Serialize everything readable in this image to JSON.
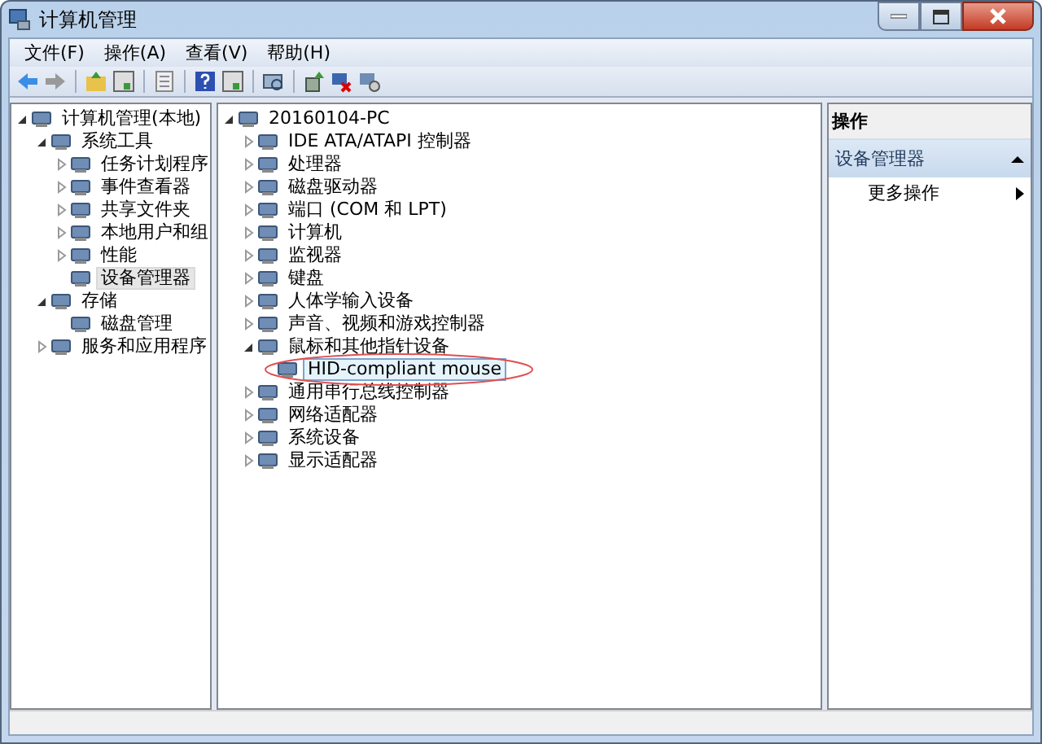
{
  "window": {
    "title": "计算机管理"
  },
  "menu": [
    "文件(F)",
    "操作(A)",
    "查看(V)",
    "帮助(H)"
  ],
  "console_tree": [
    {
      "label": "计算机管理(本地)",
      "selected": false,
      "expanded": true,
      "children": [
        {
          "label": "系统工具",
          "selected": false,
          "expanded": true,
          "children": [
            {
              "label": "任务计划程序",
              "selected": false,
              "expanded": false
            },
            {
              "label": "事件查看器",
              "selected": false,
              "expanded": false
            },
            {
              "label": "共享文件夹",
              "selected": false,
              "expanded": false
            },
            {
              "label": "本地用户和组",
              "selected": false,
              "expanded": false
            },
            {
              "label": "性能",
              "selected": false,
              "expanded": false
            },
            {
              "label": "设备管理器",
              "selected": true
            }
          ]
        },
        {
          "label": "存储",
          "selected": false,
          "expanded": true,
          "children": [
            {
              "label": "磁盘管理",
              "selected": false
            }
          ]
        },
        {
          "label": "服务和应用程序",
          "selected": false,
          "expanded": false
        }
      ]
    }
  ],
  "device_tree": [
    {
      "label": "20160104-PC",
      "selected": false,
      "expanded": true,
      "children": [
        {
          "label": "IDE ATA/ATAPI 控制器",
          "selected": false,
          "expanded": false
        },
        {
          "label": "处理器",
          "selected": false,
          "expanded": false
        },
        {
          "label": "磁盘驱动器",
          "selected": false,
          "expanded": false
        },
        {
          "label": "端口 (COM 和 LPT)",
          "selected": false,
          "expanded": false
        },
        {
          "label": "计算机",
          "selected": false,
          "expanded": false
        },
        {
          "label": "监视器",
          "selected": false,
          "expanded": false
        },
        {
          "label": "键盘",
          "selected": false,
          "expanded": false
        },
        {
          "label": "人体学输入设备",
          "selected": false,
          "expanded": false
        },
        {
          "label": "声音、视频和游戏控制器",
          "selected": false,
          "expanded": false
        },
        {
          "label": "鼠标和其他指针设备",
          "selected": false,
          "expanded": true,
          "children": [
            {
              "label": "HID-compliant mouse",
              "selected": true
            }
          ]
        },
        {
          "label": "通用串行总线控制器",
          "selected": false,
          "expanded": false
        },
        {
          "label": "网络适配器",
          "selected": false,
          "expanded": false
        },
        {
          "label": "系统设备",
          "selected": false,
          "expanded": false
        },
        {
          "label": "显示适配器",
          "selected": false,
          "expanded": false
        }
      ]
    }
  ],
  "actions": {
    "header": "操作",
    "section": {
      "label": "设备管理器",
      "expanded": true
    },
    "items": [
      "更多操作"
    ]
  }
}
